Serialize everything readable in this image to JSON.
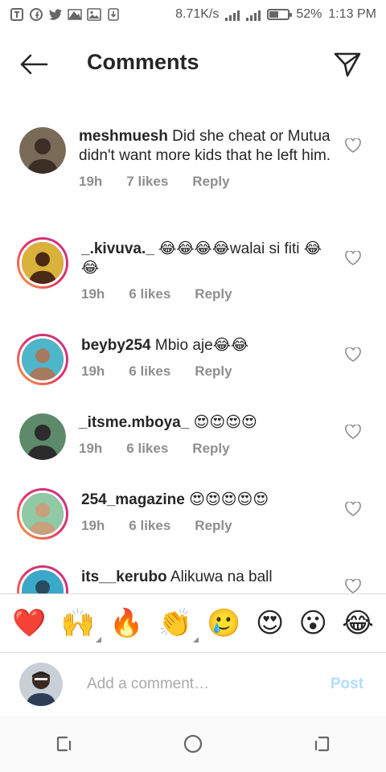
{
  "status_bar": {
    "speed": "8.71K/s",
    "battery": "52%",
    "battery_level": 0.52,
    "time": "1:13 PM",
    "left_icons": [
      "t-icon",
      "facebook-icon",
      "twitter-icon",
      "photo-icon",
      "image-icon",
      "download-icon"
    ]
  },
  "header": {
    "title": "Comments"
  },
  "comments": [
    {
      "username": "meshmuesh",
      "text": "Did she cheat or Mutua didn't want more kids that he left him.",
      "time": "19h",
      "likes": "7 likes",
      "reply": "Reply",
      "ring": false,
      "avatar_colors": [
        "#7a6a58",
        "#3b2e24"
      ]
    },
    {
      "username": "_.kivuva._",
      "text": "😂😂😂😂walai si fiti 😂😂",
      "time": "19h",
      "likes": "6 likes",
      "reply": "Reply",
      "ring": true,
      "avatar_colors": [
        "#d9b23a",
        "#4a2a14"
      ]
    },
    {
      "username": "beyby254",
      "text": "Mbio aje😂😂",
      "time": "19h",
      "likes": "6 likes",
      "reply": "Reply",
      "ring": true,
      "avatar_colors": [
        "#4db6c8",
        "#a57a5e"
      ]
    },
    {
      "username": "_itsme.mboya_",
      "text": "😍😍😍😍",
      "time": "19h",
      "likes": "6 likes",
      "reply": "Reply",
      "ring": false,
      "avatar_colors": [
        "#5d8a6a",
        "#2b2b2b"
      ]
    },
    {
      "username": "254_magazine",
      "text": "😍😍😍😍😍",
      "time": "19h",
      "likes": "6 likes",
      "reply": "Reply",
      "ring": true,
      "avatar_colors": [
        "#8fc9a5",
        "#c8a07c"
      ]
    },
    {
      "username": "its__kerubo",
      "text": "Alikuwa na ball",
      "time": "",
      "likes": "",
      "reply": "",
      "ring": true,
      "avatar_colors": [
        "#3aa9c9",
        "#2a4b5e"
      ]
    }
  ],
  "emoji_bar": [
    {
      "emoji": "❤️",
      "name": "red-heart",
      "more": false
    },
    {
      "emoji": "🙌",
      "name": "raising-hands",
      "more": true
    },
    {
      "emoji": "🔥",
      "name": "fire",
      "more": false
    },
    {
      "emoji": "👏",
      "name": "clapping-hands",
      "more": true
    },
    {
      "emoji": "🥲",
      "name": "smiling-tear",
      "more": false
    },
    {
      "emoji": "😍",
      "name": "heart-eyes",
      "more": false
    },
    {
      "emoji": "😮",
      "name": "open-mouth",
      "more": false
    },
    {
      "emoji": "😂",
      "name": "tears-of-joy",
      "more": false
    }
  ],
  "composer": {
    "placeholder": "Add a comment…",
    "post_label": "Post"
  },
  "nav": {
    "icons": [
      "recents-icon",
      "home-icon",
      "back-icon"
    ]
  },
  "colors": {
    "text": "#262626",
    "muted": "#8e8e8e",
    "post_disabled": "#b2dffc"
  }
}
